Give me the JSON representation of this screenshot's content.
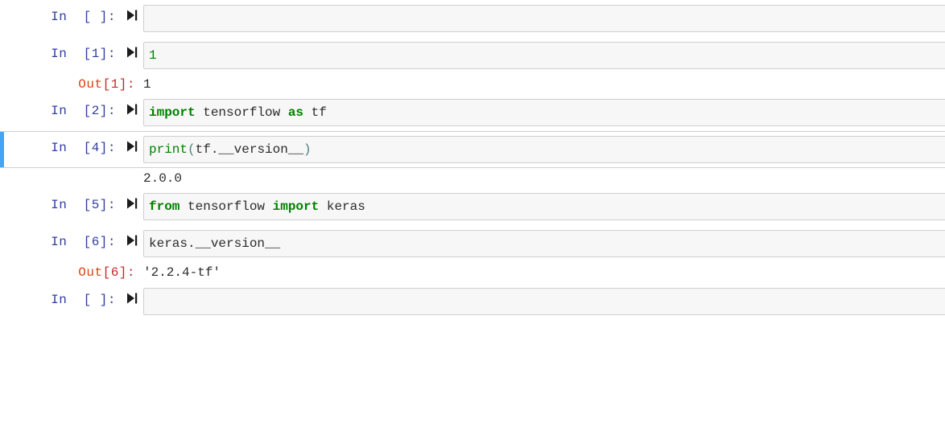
{
  "app": {
    "name": "Jupyter Notebook",
    "run_icon": "run-cell-icon"
  },
  "colors": {
    "selected_cell_bar": "#42a5f5",
    "input_background": "#f7f7f7",
    "input_border": "#cfcfcf",
    "in_prompt": "#303f9f",
    "out_prompt": "#d84315",
    "keyword": "#008000",
    "number": "#008000",
    "punctuation": "#4d7f7f",
    "text": "#2b2b2b"
  },
  "cells": [
    {
      "id": "cell-0",
      "type": "code",
      "selected": false,
      "prompt": "In  [ ]:",
      "source_plain": "",
      "empty": true,
      "tokens": [],
      "outputs": []
    },
    {
      "id": "cell-1",
      "type": "code",
      "selected": false,
      "prompt": "In  [1]:",
      "source_plain": "1",
      "empty": false,
      "tokens": [
        {
          "t": "1",
          "c": "tok-num"
        }
      ],
      "outputs": [
        {
          "kind": "execute_result",
          "prompt_pre": "Out",
          "prompt_bracket": "[1]:",
          "text": "1"
        }
      ]
    },
    {
      "id": "cell-2",
      "type": "code",
      "selected": false,
      "prompt": "In  [2]:",
      "source_plain": "import tensorflow as tf",
      "empty": false,
      "tokens": [
        {
          "t": "import",
          "c": "tok-kw"
        },
        {
          "t": " tensorflow ",
          "c": "tok-txt"
        },
        {
          "t": "as",
          "c": "tok-kw"
        },
        {
          "t": " tf",
          "c": "tok-txt"
        }
      ],
      "outputs": []
    },
    {
      "id": "cell-3",
      "type": "code",
      "selected": true,
      "prompt": "In  [4]:",
      "source_plain": "print(tf.__version__)",
      "empty": false,
      "tokens": [
        {
          "t": "print",
          "c": "tok-bi"
        },
        {
          "t": "(",
          "c": "tok-pun"
        },
        {
          "t": "tf.__version__",
          "c": "tok-txt"
        },
        {
          "t": ")",
          "c": "tok-pun"
        }
      ],
      "outputs": [
        {
          "kind": "stream",
          "prompt_pre": "",
          "prompt_bracket": "",
          "text": "2.0.0"
        }
      ]
    },
    {
      "id": "cell-4",
      "type": "code",
      "selected": false,
      "prompt": "In  [5]:",
      "source_plain": "from tensorflow import keras",
      "empty": false,
      "tokens": [
        {
          "t": "from",
          "c": "tok-kw"
        },
        {
          "t": " tensorflow ",
          "c": "tok-txt"
        },
        {
          "t": "import",
          "c": "tok-kw"
        },
        {
          "t": " keras",
          "c": "tok-txt"
        }
      ],
      "outputs": []
    },
    {
      "id": "cell-5",
      "type": "code",
      "selected": false,
      "prompt": "In  [6]:",
      "source_plain": "keras.__version__",
      "empty": false,
      "tokens": [
        {
          "t": "keras.__version__",
          "c": "tok-txt"
        }
      ],
      "outputs": [
        {
          "kind": "execute_result",
          "prompt_pre": "Out",
          "prompt_bracket": "[6]:",
          "text": "'2.2.4-tf'"
        }
      ]
    },
    {
      "id": "cell-6",
      "type": "code",
      "selected": false,
      "prompt": "In  [ ]:",
      "source_plain": "",
      "empty": true,
      "tokens": [],
      "outputs": []
    }
  ]
}
